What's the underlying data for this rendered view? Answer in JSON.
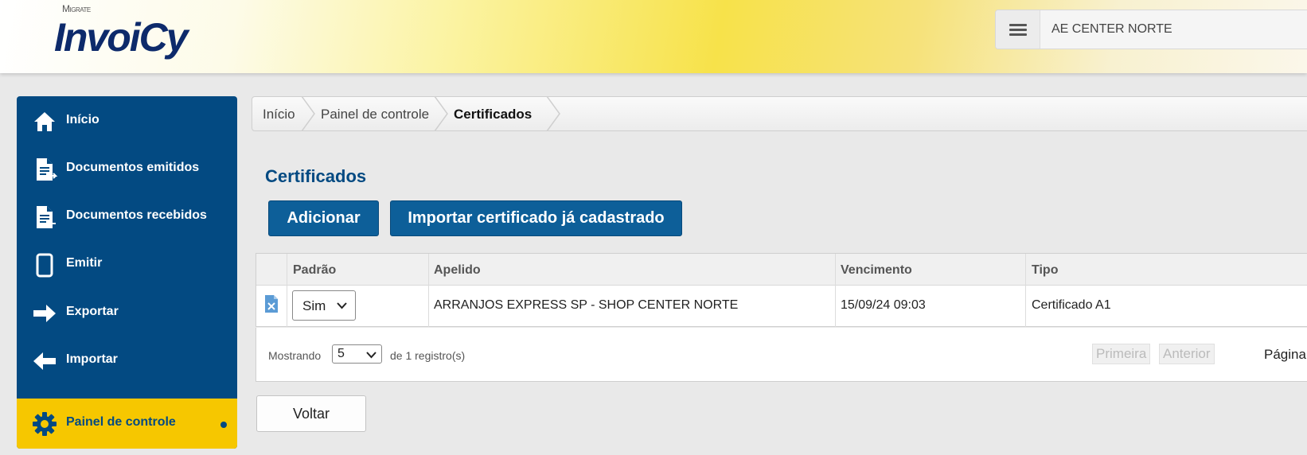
{
  "header": {
    "logo_small": "Migrate",
    "logo": "InvoiCy",
    "company": "AE CENTER NORTE"
  },
  "sidebar": {
    "items": [
      {
        "label": "Início",
        "icon": "home-icon"
      },
      {
        "label": "Documentos emitidos",
        "icon": "document-out-icon"
      },
      {
        "label": "Documentos recebidos",
        "icon": "document-in-icon"
      },
      {
        "label": "Emitir",
        "icon": "tablet-icon"
      },
      {
        "label": "Exportar",
        "icon": "arrow-right-icon"
      },
      {
        "label": "Importar",
        "icon": "arrow-left-icon"
      },
      {
        "label": "Painel de controle",
        "icon": "gear-icon",
        "active": true
      }
    ]
  },
  "breadcrumb": [
    "Início",
    "Painel de controle",
    "Certificados"
  ],
  "page": {
    "title": "Certificados",
    "add_label": "Adicionar",
    "import_label": "Importar certificado já cadastrado"
  },
  "table": {
    "headers": [
      "Padrão",
      "Apelido",
      "Vencimento",
      "Tipo"
    ],
    "rows": [
      {
        "padrao": "Sim",
        "apelido": "ARRANJOS EXPRESS SP - SHOP CENTER NORTE",
        "vencimento": "15/09/24 09:03",
        "tipo": "Certificado A1"
      }
    ]
  },
  "pager": {
    "showing_label": "Mostrando",
    "page_size": "5",
    "count_label": "de 1 registro(s)",
    "first_label": "Primeira",
    "prev_label": "Anterior",
    "page_label": "Página"
  },
  "footer": {
    "back_label": "Voltar"
  },
  "colors": {
    "primary": "#034a82",
    "accent": "#f6c700",
    "button": "#0d5f99"
  }
}
